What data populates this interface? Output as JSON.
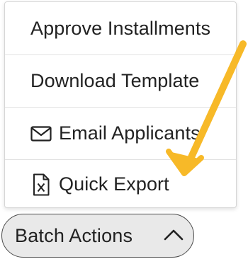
{
  "menu": {
    "items": [
      {
        "label": "Approve Installments"
      },
      {
        "label": "Download Template"
      },
      {
        "label": "Email Applicants",
        "icon": "envelope-icon"
      },
      {
        "label": "Quick Export",
        "icon": "spreadsheet-file-icon"
      }
    ]
  },
  "batch_button": {
    "label": "Batch Actions",
    "icon": "chevron-up-icon"
  },
  "annotation": {
    "arrow_color": "#f7b928"
  }
}
